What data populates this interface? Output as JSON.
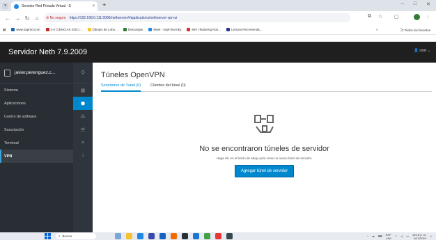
{
  "browser": {
    "tab_title": "Servidor Red Privada Virtual - S",
    "tab_close": "×",
    "new_tab": "+",
    "window_controls": [
      "–",
      "□",
      "✕"
    ],
    "security_label": "No seguro",
    "url": "https://192.168.0.111:9090/nethserver#/applications/nethserver-vpn-ui",
    "bookmarks": [
      {
        "label": "www.sapred.com",
        "color": "#1565c0"
      },
      {
        "label": "1-5 CIENCIAS SOCI...",
        "color": "#c62828"
      },
      {
        "label": "Dibujos de Lobo...",
        "color": "#fbc02d"
      },
      {
        "label": "Descargas",
        "color": "#2e7d32"
      },
      {
        "label": "Meet - mgh-fvai-nkp",
        "color": "#1e88e5"
      },
      {
        "label": "Me! | featuring Nos...",
        "color": "#d32f2f"
      },
      {
        "label": "Lectura Recomenda...",
        "color": "#283593"
      }
    ],
    "bookmarks_more": "»",
    "all_bookmarks": "Todos los favoritos"
  },
  "app": {
    "brand": "Servidor Neth 7.9.2009",
    "user": "root"
  },
  "sidebar": {
    "user": "javier.perenguez.c...",
    "items": [
      {
        "label": "Sistema",
        "active": false
      },
      {
        "label": "Aplicaciones",
        "active": false
      },
      {
        "label": "Centro de software",
        "active": false
      },
      {
        "label": "Suscripción",
        "active": false
      },
      {
        "label": "Terminal",
        "active": false
      },
      {
        "label": "VPN",
        "active": true
      }
    ]
  },
  "main": {
    "title": "Túneles OpenVPN",
    "tabs": [
      {
        "label": "Servidores de Tunel (0)",
        "active": true
      },
      {
        "label": "Clientes del túnel (0)",
        "active": false
      }
    ],
    "empty_title": "No se encontraron túneles de servidor",
    "empty_desc": "Haga clic en el botón de abajo para crear un nuevo túnel de servidor.",
    "add_button": "Agregar túnel de servidor"
  },
  "taskbar": {
    "search_placeholder": "Buscar",
    "lang": "ESP",
    "lang_sub": "LAA",
    "time": "10:18 p. m.",
    "date": "5/12/2024"
  },
  "colors": {
    "accent": "#0088ce",
    "header_bg": "#1f1f1f",
    "sidebar_bg": "#292e34",
    "insecure": "#c62828"
  }
}
